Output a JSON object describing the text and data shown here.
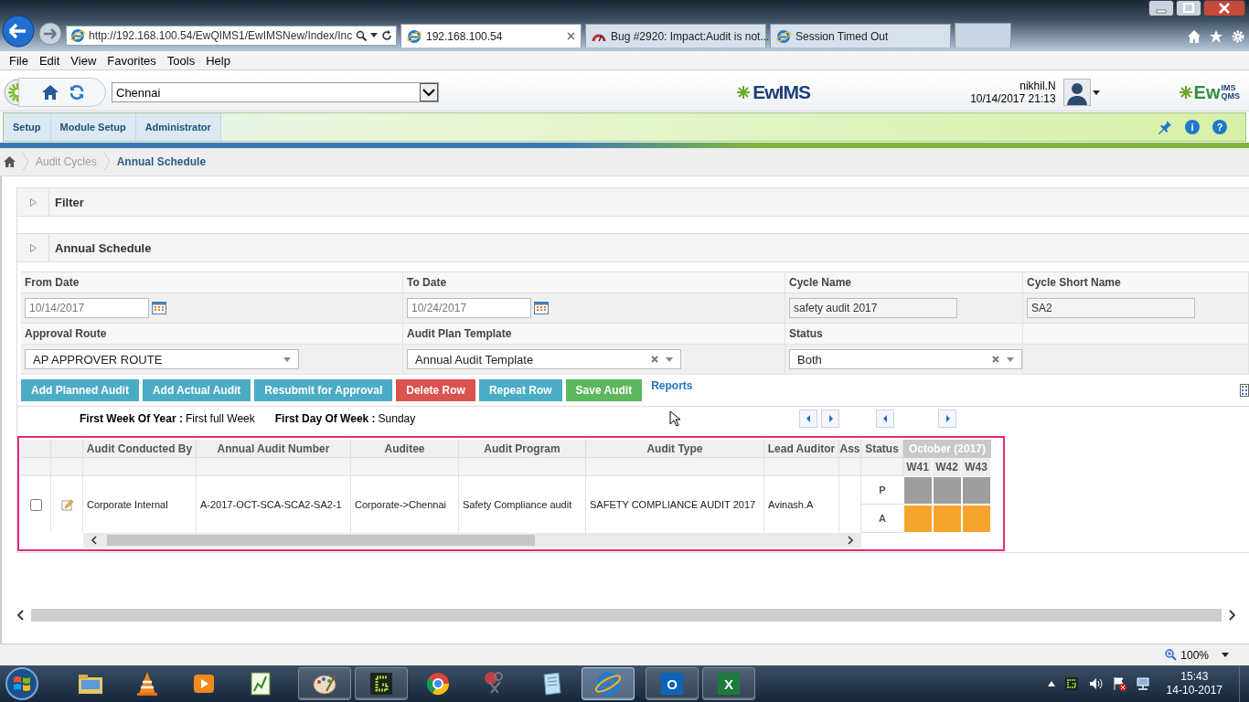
{
  "browser": {
    "address": "http://192.168.100.54/EwQIMS1/EwIMSNew/Index/Inc",
    "tabs": [
      {
        "title": "192.168.100.54",
        "selected": true,
        "kind": "ring"
      },
      {
        "title": "Bug #2920: Impact:Audit is not...",
        "selected": false,
        "kind": "gauge"
      },
      {
        "title": "Session Timed Out",
        "selected": false,
        "kind": "ring"
      }
    ],
    "menu": [
      "File",
      "Edit",
      "View",
      "Favorites",
      "Tools",
      "Help"
    ]
  },
  "header": {
    "location": "Chennai",
    "logo": "EwIMS",
    "user": "nikhil.N",
    "datetime": "10/14/2017 21:13",
    "brand": {
      "main": "Ew",
      "top": "IMS",
      "bottom": "QMS"
    }
  },
  "nav": {
    "items": [
      "Setup",
      "Module Setup",
      "Administrator"
    ],
    "tools": [
      "i",
      "?"
    ]
  },
  "breadcrumb": [
    "Audit Cycles",
    "Annual Schedule"
  ],
  "panels": [
    {
      "title": "Filter"
    },
    {
      "title": "Annual Schedule"
    }
  ],
  "form": [
    [
      {
        "label": "From Date",
        "value": "10/14/2017",
        "kind": "date"
      },
      {
        "label": "To Date",
        "value": "10/24/2017",
        "kind": "date"
      },
      {
        "label": "Cycle Name",
        "value": "safety audit 2017",
        "kind": "text"
      },
      {
        "label": "Cycle Short Name",
        "value": "SA2",
        "kind": "text"
      }
    ],
    [
      {
        "label": "Approval Route",
        "value": "AP APPROVER ROUTE",
        "kind": "select",
        "clearable": false
      },
      {
        "label": "Audit Plan Template",
        "value": "Annual Audit Template",
        "kind": "select",
        "clearable": true
      },
      {
        "label": "Status",
        "value": "Both",
        "kind": "select",
        "clearable": true
      }
    ]
  ],
  "toolbar": {
    "buttons": [
      {
        "label": "Add Planned Audit",
        "color": "#4bacc6"
      },
      {
        "label": "Add Actual Audit",
        "color": "#4bacc6"
      },
      {
        "label": "Resubmit for Approval",
        "color": "#4bacc6"
      },
      {
        "label": "Delete Row",
        "color": "#d9534f"
      },
      {
        "label": "Repeat Row",
        "color": "#4bacc6"
      },
      {
        "label": "Save Audit",
        "color": "#5cb85c"
      }
    ],
    "link": "Reports"
  },
  "week_info": [
    {
      "label": "First Week Of Year :",
      "value": "First full Week"
    },
    {
      "label": "First Day Of Week :",
      "value": "Sunday"
    }
  ],
  "table": {
    "columns": [
      "Audit Conducted By",
      "Annual Audit Number",
      "Auditee",
      "Audit Program",
      "Audit Type",
      "Lead Auditor",
      "Ass"
    ],
    "rows": [
      {
        "checked": false,
        "cells": [
          "Corporate Internal",
          "A-2017-OCT-SCA-SCA2-SA2-1",
          "Corporate->Chennai",
          "Safety Compliance audit",
          "SAFETY COMPLIANCE AUDIT 2017",
          "Avinash.A",
          ""
        ]
      }
    ],
    "status": {
      "heading": "Status",
      "month": "October (2017)",
      "weeks": [
        "W41",
        "W42",
        "W43"
      ],
      "rows": [
        {
          "label": "P",
          "color": "#9e9e9e"
        },
        {
          "label": "A",
          "color": "#f5a52c"
        }
      ]
    }
  },
  "status_bar": {
    "zoom": "100%"
  },
  "taskbar": {
    "apps": [
      {
        "kind": "folder",
        "running": false,
        "selected": false
      },
      {
        "kind": "cone",
        "running": false,
        "selected": false
      },
      {
        "kind": "play",
        "running": false,
        "selected": false
      },
      {
        "kind": "chart",
        "running": false,
        "selected": false
      },
      {
        "kind": "palette",
        "running": true,
        "selected": false
      },
      {
        "kind": "snake",
        "running": true,
        "selected": false
      },
      {
        "kind": "ball",
        "running": false,
        "selected": false
      },
      {
        "kind": "scissors",
        "running": false,
        "selected": false
      },
      {
        "kind": "notebook",
        "running": false,
        "selected": false
      },
      {
        "kind": "ring",
        "running": true,
        "selected": true
      },
      {
        "kind": "mail",
        "running": true,
        "selected": false,
        "glyph": "O"
      },
      {
        "kind": "sheet",
        "running": true,
        "selected": false,
        "glyph": "X"
      }
    ],
    "time": "15:43",
    "date": "14-10-2017"
  }
}
